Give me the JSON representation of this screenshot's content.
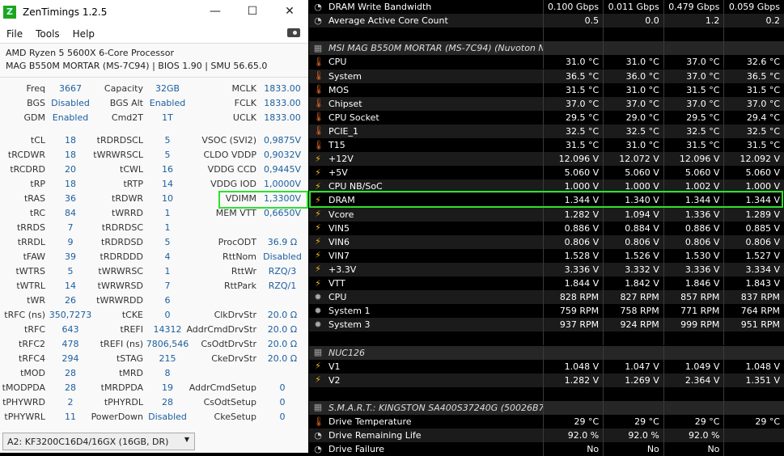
{
  "zen": {
    "title": "ZenTimings 1.2.5",
    "logo": "Z",
    "menu": [
      "File",
      "Tools",
      "Help"
    ],
    "cpu": "AMD Ryzen 5 5600X 6-Core Processor",
    "board": "MAG B550M MORTAR (MS-7C94) | BIOS 1.90 | SMU 56.65.0",
    "top": [
      [
        "Freq",
        "3667",
        "Capacity",
        "32GB",
        "MCLK",
        "1833.00"
      ],
      [
        "BGS",
        "Disabled",
        "BGS Alt",
        "Enabled",
        "FCLK",
        "1833.00"
      ],
      [
        "GDM",
        "Enabled",
        "Cmd2T",
        "1T",
        "UCLK",
        "1833.00"
      ]
    ],
    "rows": [
      [
        "tCL",
        "18",
        "tRDRDSCL",
        "5",
        "VSOC (SVI2)",
        "0,9875V"
      ],
      [
        "tRCDWR",
        "18",
        "tWRWRSCL",
        "5",
        "CLDO VDDP",
        "0,9032V"
      ],
      [
        "tRCDRD",
        "20",
        "tCWL",
        "16",
        "VDDG CCD",
        "0,9445V"
      ],
      [
        "tRP",
        "18",
        "tRTP",
        "14",
        "VDDG IOD",
        "1,0000V"
      ],
      [
        "tRAS",
        "36",
        "tRDWR",
        "10",
        "VDIMM",
        "1,3300V"
      ],
      [
        "tRC",
        "84",
        "tWRRD",
        "1",
        "MEM VTT",
        "0,6650V"
      ],
      [
        "tRRDS",
        "7",
        "tRDRDSC",
        "1",
        "",
        ""
      ],
      [
        "tRRDL",
        "9",
        "tRDRDSD",
        "5",
        "ProcODT",
        "36.9 Ω"
      ],
      [
        "tFAW",
        "39",
        "tRDRDDD",
        "4",
        "RttNom",
        "Disabled"
      ],
      [
        "tWTRS",
        "5",
        "tWRWRSC",
        "1",
        "RttWr",
        "RZQ/3"
      ],
      [
        "tWTRL",
        "14",
        "tWRWRSD",
        "7",
        "RttPark",
        "RZQ/1"
      ],
      [
        "tWR",
        "26",
        "tWRWRDD",
        "6",
        "",
        ""
      ],
      [
        "tRFC (ns)",
        "350,7273",
        "tCKE",
        "0",
        "ClkDrvStr",
        "20.0 Ω"
      ],
      [
        "tRFC",
        "643",
        "tREFI",
        "14312",
        "AddrCmdDrvStr",
        "20.0 Ω"
      ],
      [
        "tRFC2",
        "478",
        "tREFI (ns)",
        "7806,546",
        "CsOdtDrvStr",
        "20.0 Ω"
      ],
      [
        "tRFC4",
        "294",
        "tSTAG",
        "215",
        "CkeDrvStr",
        "20.0 Ω"
      ],
      [
        "tMOD",
        "28",
        "tMRD",
        "8",
        "",
        ""
      ],
      [
        "tMODPDA",
        "28",
        "tMRDPDA",
        "19",
        "AddrCmdSetup",
        "0"
      ],
      [
        "tPHYWRD",
        "2",
        "tPHYRDL",
        "28",
        "CsOdtSetup",
        "0"
      ],
      [
        "tPHYWRL",
        "11",
        "PowerDown",
        "Disabled",
        "CkeSetup",
        "0"
      ]
    ],
    "module": "A2: KF3200C16D4/16GX (16GB, DR)"
  },
  "hw": {
    "highlight_color": "#2fe02f",
    "rows": [
      {
        "icon": "gauge",
        "label": "DRAM Write Bandwidth",
        "v": [
          "0.100 Gbps",
          "0.011 Gbps",
          "0.479 Gbps",
          "0.059 Gbps"
        ]
      },
      {
        "icon": "gauge",
        "label": "Average Active Core Count",
        "v": [
          "0.5",
          "0.0",
          "1.2",
          "0.2"
        ]
      },
      {
        "icon": "",
        "label": "",
        "v": [
          "",
          "",
          "",
          ""
        ]
      },
      {
        "icon": "chip",
        "label": "MSI MAG B550M MORTAR (MS-7C94) (Nuvoton NC...",
        "header": true,
        "v": [
          "",
          "",
          "",
          ""
        ]
      },
      {
        "icon": "thermometer",
        "label": "CPU",
        "v": [
          "31.0 °C",
          "31.0 °C",
          "37.0 °C",
          "32.6 °C"
        ]
      },
      {
        "icon": "thermometer",
        "label": "System",
        "v": [
          "36.5 °C",
          "36.0 °C",
          "37.0 °C",
          "36.5 °C"
        ]
      },
      {
        "icon": "thermometer",
        "label": "MOS",
        "v": [
          "31.5 °C",
          "31.0 °C",
          "31.5 °C",
          "31.5 °C"
        ]
      },
      {
        "icon": "thermometer",
        "label": "Chipset",
        "v": [
          "37.0 °C",
          "37.0 °C",
          "37.0 °C",
          "37.0 °C"
        ]
      },
      {
        "icon": "thermometer",
        "label": "CPU Socket",
        "v": [
          "29.5 °C",
          "29.0 °C",
          "29.5 °C",
          "29.4 °C"
        ]
      },
      {
        "icon": "thermometer",
        "label": "PCIE_1",
        "v": [
          "32.5 °C",
          "32.5 °C",
          "32.5 °C",
          "32.5 °C"
        ]
      },
      {
        "icon": "thermometer",
        "label": "T15",
        "v": [
          "31.5 °C",
          "31.0 °C",
          "31.5 °C",
          "31.5 °C"
        ]
      },
      {
        "icon": "bolt",
        "label": "+12V",
        "v": [
          "12.096 V",
          "12.072 V",
          "12.096 V",
          "12.092 V"
        ]
      },
      {
        "icon": "bolt",
        "label": "+5V",
        "v": [
          "5.060 V",
          "5.060 V",
          "5.060 V",
          "5.060 V"
        ]
      },
      {
        "icon": "bolt",
        "label": "CPU NB/SoC",
        "v": [
          "1.000 V",
          "1.000 V",
          "1.002 V",
          "1.000 V"
        ]
      },
      {
        "icon": "bolt",
        "label": "DRAM",
        "v": [
          "1.344 V",
          "1.340 V",
          "1.344 V",
          "1.344 V"
        ]
      },
      {
        "icon": "bolt",
        "label": "Vcore",
        "v": [
          "1.282 V",
          "1.094 V",
          "1.336 V",
          "1.289 V"
        ]
      },
      {
        "icon": "bolt",
        "label": "VIN5",
        "v": [
          "0.886 V",
          "0.884 V",
          "0.886 V",
          "0.885 V"
        ]
      },
      {
        "icon": "bolt",
        "label": "VIN6",
        "v": [
          "0.806 V",
          "0.806 V",
          "0.806 V",
          "0.806 V"
        ]
      },
      {
        "icon": "bolt",
        "label": "VIN7",
        "v": [
          "1.528 V",
          "1.526 V",
          "1.530 V",
          "1.527 V"
        ]
      },
      {
        "icon": "bolt",
        "label": "+3.3V",
        "v": [
          "3.336 V",
          "3.332 V",
          "3.336 V",
          "3.334 V"
        ]
      },
      {
        "icon": "bolt",
        "label": "VTT",
        "v": [
          "1.844 V",
          "1.842 V",
          "1.846 V",
          "1.843 V"
        ]
      },
      {
        "icon": "fan",
        "label": "CPU",
        "v": [
          "828 RPM",
          "827 RPM",
          "857 RPM",
          "837 RPM"
        ]
      },
      {
        "icon": "fan",
        "label": "System 1",
        "v": [
          "759 RPM",
          "758 RPM",
          "771 RPM",
          "764 RPM"
        ]
      },
      {
        "icon": "fan",
        "label": "System 3",
        "v": [
          "937 RPM",
          "924 RPM",
          "999 RPM",
          "951 RPM"
        ]
      },
      {
        "icon": "",
        "label": "",
        "v": [
          "",
          "",
          "",
          ""
        ]
      },
      {
        "icon": "chip",
        "label": "NUC126",
        "header": true,
        "v": [
          "",
          "",
          "",
          ""
        ]
      },
      {
        "icon": "bolt",
        "label": "V1",
        "v": [
          "1.048 V",
          "1.047 V",
          "1.049 V",
          "1.048 V"
        ]
      },
      {
        "icon": "bolt",
        "label": "V2",
        "v": [
          "1.282 V",
          "1.269 V",
          "2.364 V",
          "1.351 V"
        ]
      },
      {
        "icon": "",
        "label": "",
        "v": [
          "",
          "",
          "",
          ""
        ]
      },
      {
        "icon": "chip",
        "label": "S.M.A.R.T.: KINGSTON SA400S37240G (50026B77...",
        "header": true,
        "v": [
          "",
          "",
          "",
          ""
        ]
      },
      {
        "icon": "thermometer",
        "label": "Drive Temperature",
        "v": [
          "29 °C",
          "29 °C",
          "29 °C",
          "29 °C"
        ]
      },
      {
        "icon": "gauge",
        "label": "Drive Remaining Life",
        "v": [
          "92.0 %",
          "92.0 %",
          "92.0 %",
          ""
        ]
      },
      {
        "icon": "gauge",
        "label": "Drive Failure",
        "v": [
          "No",
          "No",
          "No",
          ""
        ]
      }
    ]
  }
}
